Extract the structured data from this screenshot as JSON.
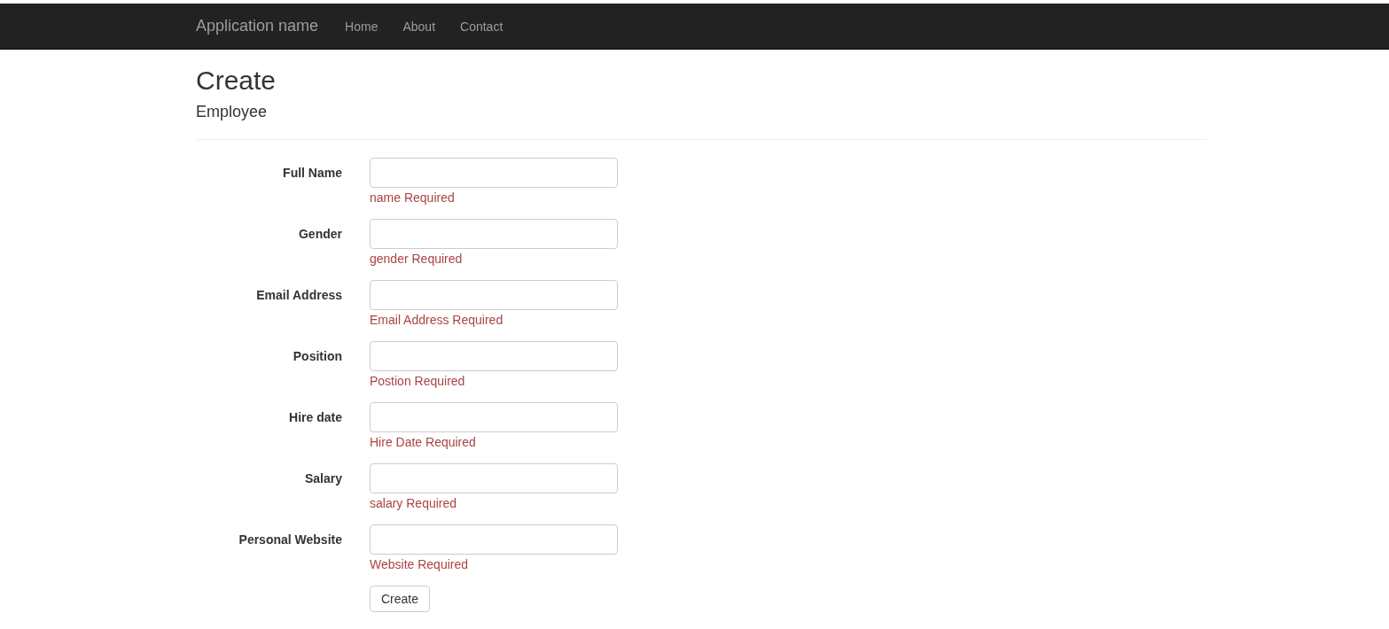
{
  "navbar": {
    "brand": "Application name",
    "links": [
      "Home",
      "About",
      "Contact"
    ]
  },
  "page": {
    "title": "Create",
    "subtitle": "Employee"
  },
  "form": {
    "fields": [
      {
        "label": "Full Name",
        "error": "name Required"
      },
      {
        "label": "Gender",
        "error": "gender Required"
      },
      {
        "label": "Email Address",
        "error": "Email Address Required"
      },
      {
        "label": "Position",
        "error": "Postion Required"
      },
      {
        "label": "Hire date",
        "error": "Hire Date Required"
      },
      {
        "label": "Salary",
        "error": "salary Required"
      },
      {
        "label": "Personal Website",
        "error": "Website Required"
      }
    ],
    "submit": "Create"
  }
}
